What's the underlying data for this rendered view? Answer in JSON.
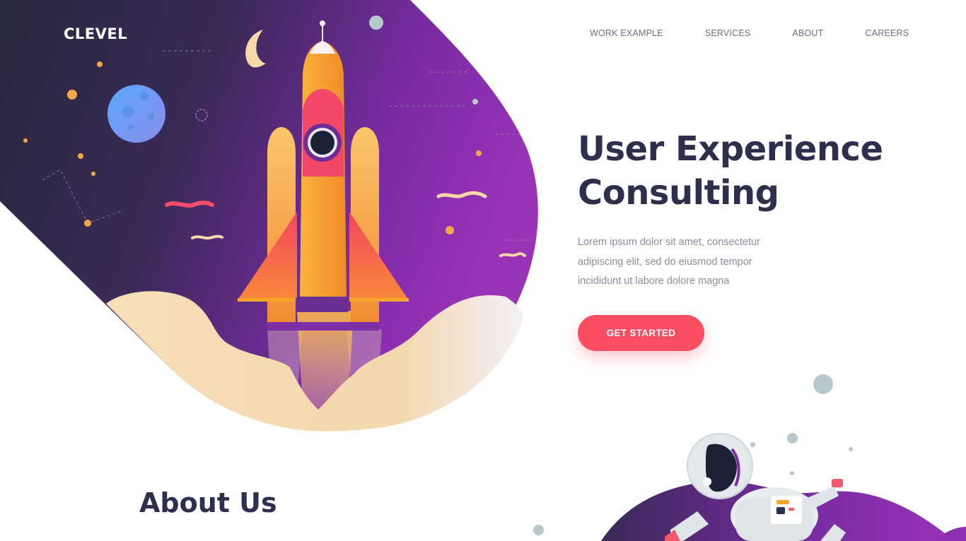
{
  "brand": {
    "name": "CLEVEL"
  },
  "nav": {
    "items": [
      "WORK EXAMPLE",
      "SERVICES",
      "ABOUT",
      "CAREERS"
    ]
  },
  "hero": {
    "title": "User Experience Consulting",
    "description": "Lorem ipsum dolor sit amet, consectetur adipiscing elit, sed do eiusmod tempor incididunt ut labore dolore magna",
    "cta_label": "GET STARTED"
  },
  "about": {
    "title": "About Us"
  },
  "colors": {
    "accent": "#fb4d62",
    "heading": "#2e2f4d",
    "body_text": "#8b8ca0",
    "nav_text": "#6d6f86",
    "space_dark": "#2b2740",
    "space_purple": "#8c2fb0",
    "rocket_orange": "#f7a42a",
    "cloud": "#f5dcb1"
  },
  "icons": [
    "rocket-illustration",
    "moon-icon",
    "planet-icon",
    "astronaut-illustration"
  ]
}
